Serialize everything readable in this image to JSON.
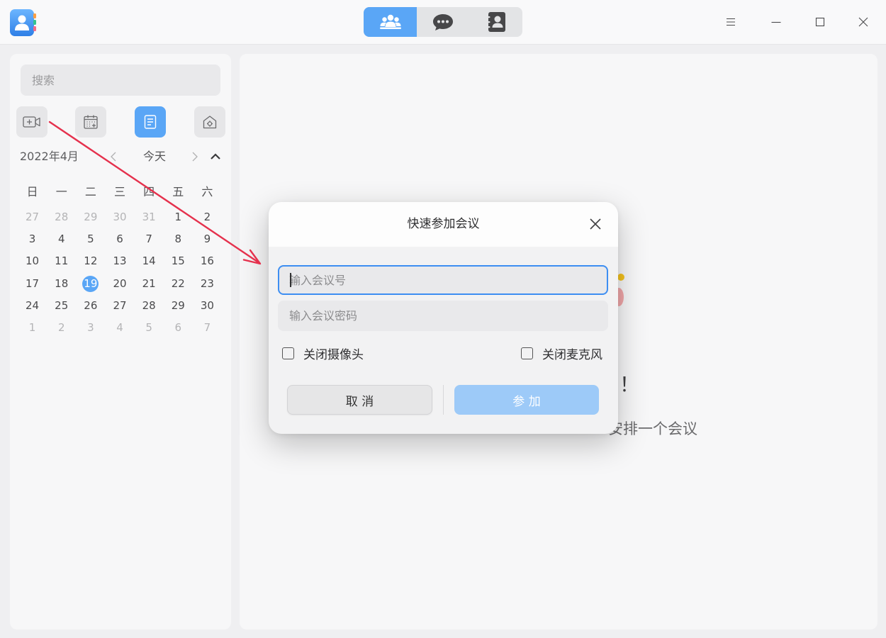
{
  "titlebar": {
    "app_icon": "contacts-app-icon",
    "view_tabs": [
      {
        "icon": "people-group-icon",
        "selected": true
      },
      {
        "icon": "chat-bubble-icon",
        "selected": false
      },
      {
        "icon": "contact-card-icon",
        "selected": false
      }
    ],
    "window_controls": [
      "menu-icon",
      "minimize-icon",
      "maximize-icon",
      "close-icon"
    ]
  },
  "sidebar": {
    "search": {
      "placeholder": "搜索",
      "value": ""
    },
    "toolbar": [
      {
        "icon": "video-add-icon",
        "selected": false
      },
      {
        "icon": "calendar-add-icon",
        "selected": false
      },
      {
        "icon": "list-icon",
        "selected": true
      },
      {
        "icon": "camera-home-icon",
        "selected": false
      }
    ],
    "calendar": {
      "month_label": "2022年4月",
      "prev_icon": "chevron-left-icon",
      "today_label": "今天",
      "next_icon": "chevron-right-icon",
      "collapse_icon": "chevron-up-icon",
      "weekdays": [
        "日",
        "一",
        "二",
        "三",
        "四",
        "五",
        "六"
      ],
      "weeks": [
        [
          {
            "d": 27,
            "muted": true
          },
          {
            "d": 28,
            "muted": true
          },
          {
            "d": 29,
            "muted": true
          },
          {
            "d": 30,
            "muted": true
          },
          {
            "d": 31,
            "muted": true
          },
          {
            "d": 1
          },
          {
            "d": 2
          }
        ],
        [
          {
            "d": 3
          },
          {
            "d": 4
          },
          {
            "d": 5
          },
          {
            "d": 6
          },
          {
            "d": 7
          },
          {
            "d": 8
          },
          {
            "d": 9
          }
        ],
        [
          {
            "d": 10
          },
          {
            "d": 11
          },
          {
            "d": 12
          },
          {
            "d": 13
          },
          {
            "d": 14
          },
          {
            "d": 15
          },
          {
            "d": 16
          }
        ],
        [
          {
            "d": 17
          },
          {
            "d": 18
          },
          {
            "d": 19,
            "selected": true
          },
          {
            "d": 20
          },
          {
            "d": 21
          },
          {
            "d": 22
          },
          {
            "d": 23
          }
        ],
        [
          {
            "d": 24
          },
          {
            "d": 25
          },
          {
            "d": 26
          },
          {
            "d": 27
          },
          {
            "d": 28
          },
          {
            "d": 29
          },
          {
            "d": 30
          }
        ],
        [
          {
            "d": 1,
            "muted": true
          },
          {
            "d": 2,
            "muted": true
          },
          {
            "d": 3,
            "muted": true
          },
          {
            "d": 4,
            "muted": true
          },
          {
            "d": 5,
            "muted": true
          },
          {
            "d": 6,
            "muted": true
          },
          {
            "d": 7,
            "muted": true
          }
        ]
      ]
    }
  },
  "main": {
    "welcome_fragment": "！",
    "hint_fragment": "安排一个会议"
  },
  "dialog": {
    "title": "快速参加会议",
    "close_icon": "close-icon",
    "meeting_id": {
      "placeholder": "输入会议号",
      "value": "",
      "focused": true
    },
    "password": {
      "placeholder": "输入会议密码",
      "value": ""
    },
    "options": [
      {
        "label": "关闭摄像头",
        "checked": false
      },
      {
        "label": "关闭麦克风",
        "checked": false
      }
    ],
    "cancel_label": "取 消",
    "join_label": "参 加",
    "join_enabled": false
  },
  "colors": {
    "accent": "#5aa6f6",
    "accent_disabled": "#9dcaf8",
    "focus_border": "#3d8ef2",
    "annotation_arrow": "#e5314d"
  }
}
